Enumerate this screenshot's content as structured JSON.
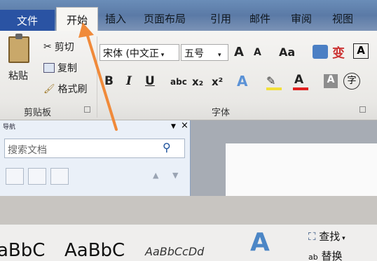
{
  "tabs": {
    "file": "文件",
    "home": "开始",
    "insert": "插入",
    "page_layout": "页面布局",
    "references": "引用",
    "mailings": "邮件",
    "review": "审阅",
    "view": "视图"
  },
  "clipboard": {
    "paste": "粘贴",
    "cut": "剪切",
    "copy": "复制",
    "format_painter": "格式刷",
    "group_label": "剪贴板"
  },
  "font": {
    "font_name": "宋体 (中文正",
    "font_size": "五号",
    "grow": "A",
    "shrink": "A",
    "change_case": "Aa",
    "bold": "B",
    "italic": "I",
    "underline": "U",
    "strikethrough": "abc",
    "subscript": "x₂",
    "superscript": "x²",
    "text_effects": "A",
    "font_color": "A",
    "char_shading": "A",
    "enclose": "字",
    "group_label": "字体"
  },
  "nav": {
    "title": "导航",
    "search_placeholder": "搜索文档",
    "close": "×"
  },
  "styles": {
    "sample1": "aBbC",
    "sample2": "AaBbC",
    "sample3": "AaBbCcDd"
  },
  "editing": {
    "find": "查找",
    "replace": "替换"
  },
  "colors": {
    "file_tab": "#2a53a3",
    "arrow": "#f08a3a"
  }
}
